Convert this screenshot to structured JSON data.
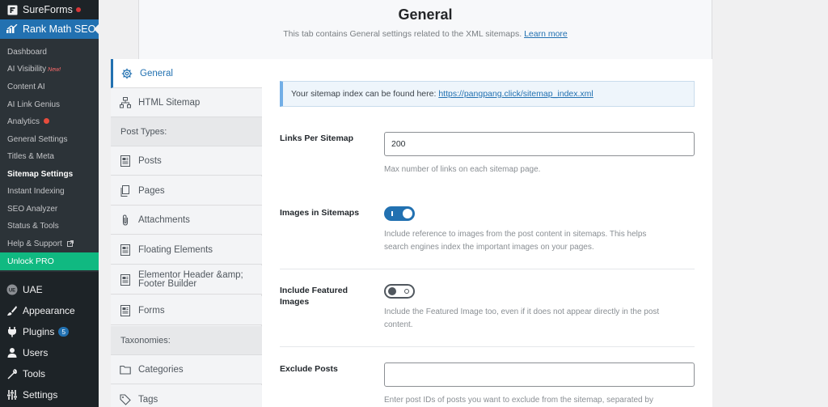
{
  "sidebar": {
    "top_items": [
      {
        "label": "SureForms",
        "icon": "sureforms-icon"
      },
      {
        "label": "Rank Math SEO",
        "icon": "rankmath-icon"
      }
    ],
    "submenu": [
      {
        "label": "Dashboard"
      },
      {
        "label": "AI Visibility",
        "tag": "New!"
      },
      {
        "label": "Content AI"
      },
      {
        "label": "AI Link Genius"
      },
      {
        "label": "Analytics",
        "dot": true
      },
      {
        "label": "General Settings"
      },
      {
        "label": "Titles & Meta"
      },
      {
        "label": "Sitemap Settings",
        "current": true
      },
      {
        "label": "Instant Indexing"
      },
      {
        "label": "SEO Analyzer"
      },
      {
        "label": "Status & Tools"
      },
      {
        "label": "Help & Support",
        "external": true
      }
    ],
    "unlock_pro": "Unlock PRO",
    "menu": [
      {
        "label": "UAE",
        "icon": "uae-icon"
      },
      {
        "label": "Appearance",
        "icon": "paintbrush-icon"
      },
      {
        "label": "Plugins",
        "icon": "plugin-icon",
        "badge": "5"
      },
      {
        "label": "Users",
        "icon": "users-icon"
      },
      {
        "label": "Tools",
        "icon": "wrench-icon"
      },
      {
        "label": "Settings",
        "icon": "settings-icon"
      }
    ],
    "colors": {
      "bg": "#1d2327",
      "active": "#2271b1",
      "pro": "#10b981"
    }
  },
  "header": {
    "title": "General",
    "description": "This tab contains General settings related to the XML sitemaps.",
    "learn_more": "Learn more"
  },
  "tabs": {
    "general": "General",
    "html_sitemap": "HTML Sitemap",
    "post_types_heading": "Post Types:",
    "posts": "Posts",
    "pages": "Pages",
    "attachments": "Attachments",
    "floating_elements": "Floating Elements",
    "elementor_line1": "Elementor Header &amp;",
    "elementor_line2": "Footer Builder",
    "forms": "Forms",
    "taxonomies_heading": "Taxonomies:",
    "categories": "Categories",
    "tags": "Tags"
  },
  "main": {
    "notice_text": "Your sitemap index can be found here:",
    "notice_link": "https://pangpang.click/sitemap_index.xml",
    "links_per_sitemap": {
      "label": "Links Per Sitemap",
      "value": "200",
      "description": "Max number of links on each sitemap page."
    },
    "images_in_sitemaps": {
      "label": "Images in Sitemaps",
      "enabled": true,
      "description_line1": "Include reference to images from the post content in sitemaps. This helps",
      "description_line2": "search engines index the important images on your pages."
    },
    "include_featured_images": {
      "label_line1": "Include Featured",
      "label_line2": "Images",
      "enabled": false,
      "description_line1": "Include the Featured Image too, even if it does not appear directly in the post",
      "description_line2": "content."
    },
    "exclude_posts": {
      "label": "Exclude Posts",
      "value": "",
      "description": "Enter post IDs of posts you want to exclude from the sitemap, separated by"
    }
  }
}
